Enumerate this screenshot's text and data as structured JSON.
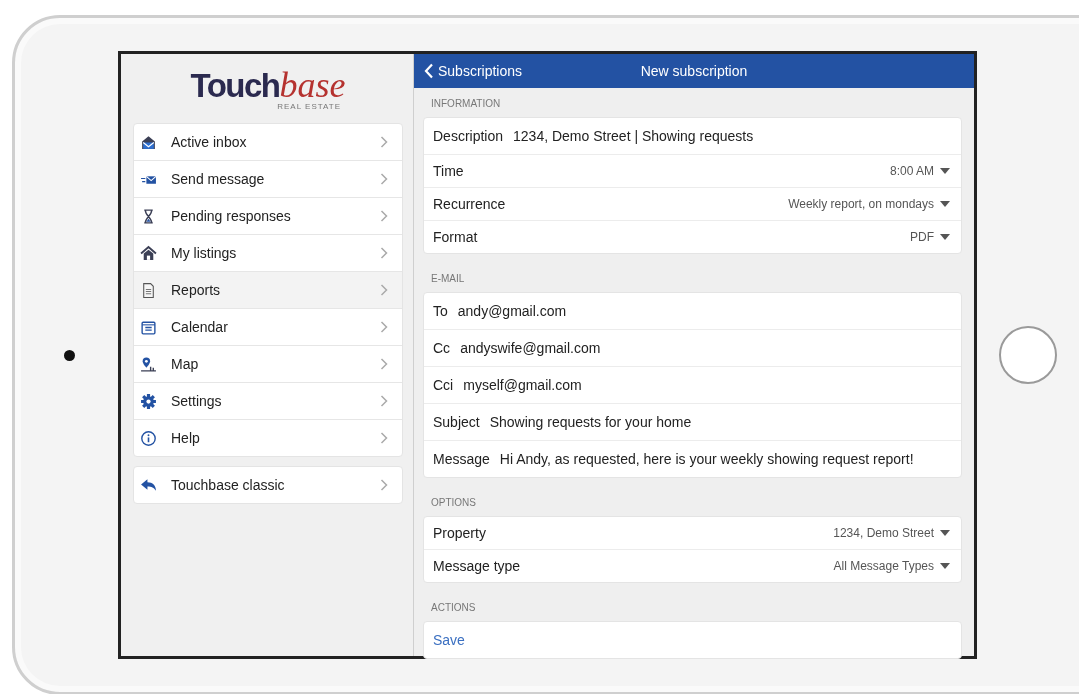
{
  "logo": {
    "word": "Touch",
    "accent": "base",
    "tagline": "REAL ESTATE"
  },
  "menu": [
    {
      "label": "Active inbox",
      "selected": false
    },
    {
      "label": "Send message",
      "selected": false
    },
    {
      "label": "Pending responses",
      "selected": false
    },
    {
      "label": "My listings",
      "selected": false
    },
    {
      "label": "Reports",
      "selected": true
    },
    {
      "label": "Calendar",
      "selected": false
    },
    {
      "label": "Map",
      "selected": false
    },
    {
      "label": "Settings",
      "selected": false
    },
    {
      "label": "Help",
      "selected": false
    }
  ],
  "menu_footer": [
    {
      "label": "Touchbase classic",
      "selected": false
    }
  ],
  "nav_bar": {
    "back": "Subscriptions",
    "title": "New subscription"
  },
  "sections": [
    {
      "title": "INFORMATION",
      "rows": [
        {
          "kind": "text",
          "label": "Description",
          "value": "1234, Demo Street | Showing requests"
        },
        {
          "kind": "select",
          "label": "Time",
          "value": "8:00 AM"
        },
        {
          "kind": "select",
          "label": "Recurrence",
          "value": "Weekly report, on mondays"
        },
        {
          "kind": "select",
          "label": "Format",
          "value": "PDF"
        }
      ]
    },
    {
      "title": "E-MAIL",
      "rows": [
        {
          "kind": "text",
          "label": "To",
          "value": "andy@gmail.com"
        },
        {
          "kind": "text",
          "label": "Cc",
          "value": "andyswife@gmail.com"
        },
        {
          "kind": "text",
          "label": "Cci",
          "value": "myself@gmail.com"
        },
        {
          "kind": "text",
          "label": "Subject",
          "value": "Showing requests for your home"
        },
        {
          "kind": "text",
          "label": "Message",
          "value": "Hi Andy, as requested, here is your weekly showing request report!"
        }
      ]
    },
    {
      "title": "OPTIONS",
      "rows": [
        {
          "kind": "select",
          "label": "Property",
          "value": "1234, Demo Street"
        },
        {
          "kind": "select",
          "label": "Message type",
          "value": "All Message Types"
        }
      ]
    },
    {
      "title": "ACTIONS",
      "rows": [
        {
          "kind": "action",
          "label": "Save"
        }
      ]
    }
  ]
}
